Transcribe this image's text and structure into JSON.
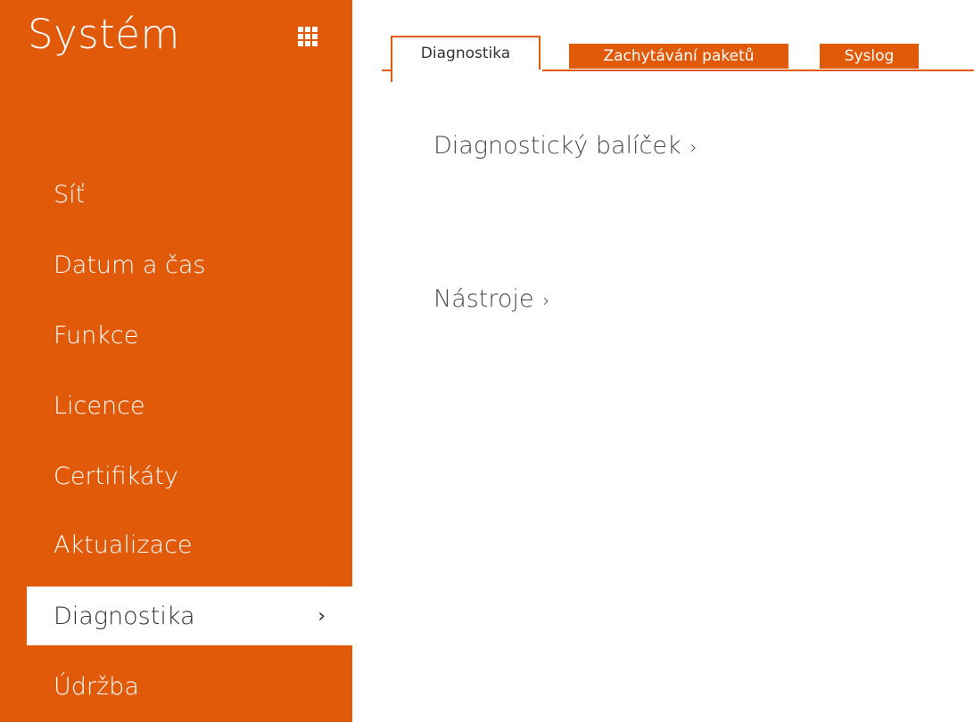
{
  "sidebar": {
    "title": "Systém",
    "grid_icon": "apps-grid-icon",
    "items": [
      {
        "label": "Síť"
      },
      {
        "label": "Datum a čas"
      },
      {
        "label": "Funkce"
      },
      {
        "label": "Licence"
      },
      {
        "label": "Certifikáty"
      },
      {
        "label": "Aktualizace"
      },
      {
        "label": "Diagnostika",
        "active": true
      },
      {
        "label": "Údržba"
      }
    ],
    "chevron": "›"
  },
  "tabs": [
    {
      "label": "Diagnostika",
      "active": true
    },
    {
      "label": "Zachytávání paketů"
    },
    {
      "label": "Syslog"
    }
  ],
  "main": {
    "sections": [
      {
        "label": "Diagnostický balíček",
        "chevron": "›"
      },
      {
        "label": "Nástroje",
        "chevron": "›"
      }
    ]
  },
  "colors": {
    "accent": "#e05a0a",
    "text": "#4a4a4a",
    "background": "#ffffff"
  }
}
